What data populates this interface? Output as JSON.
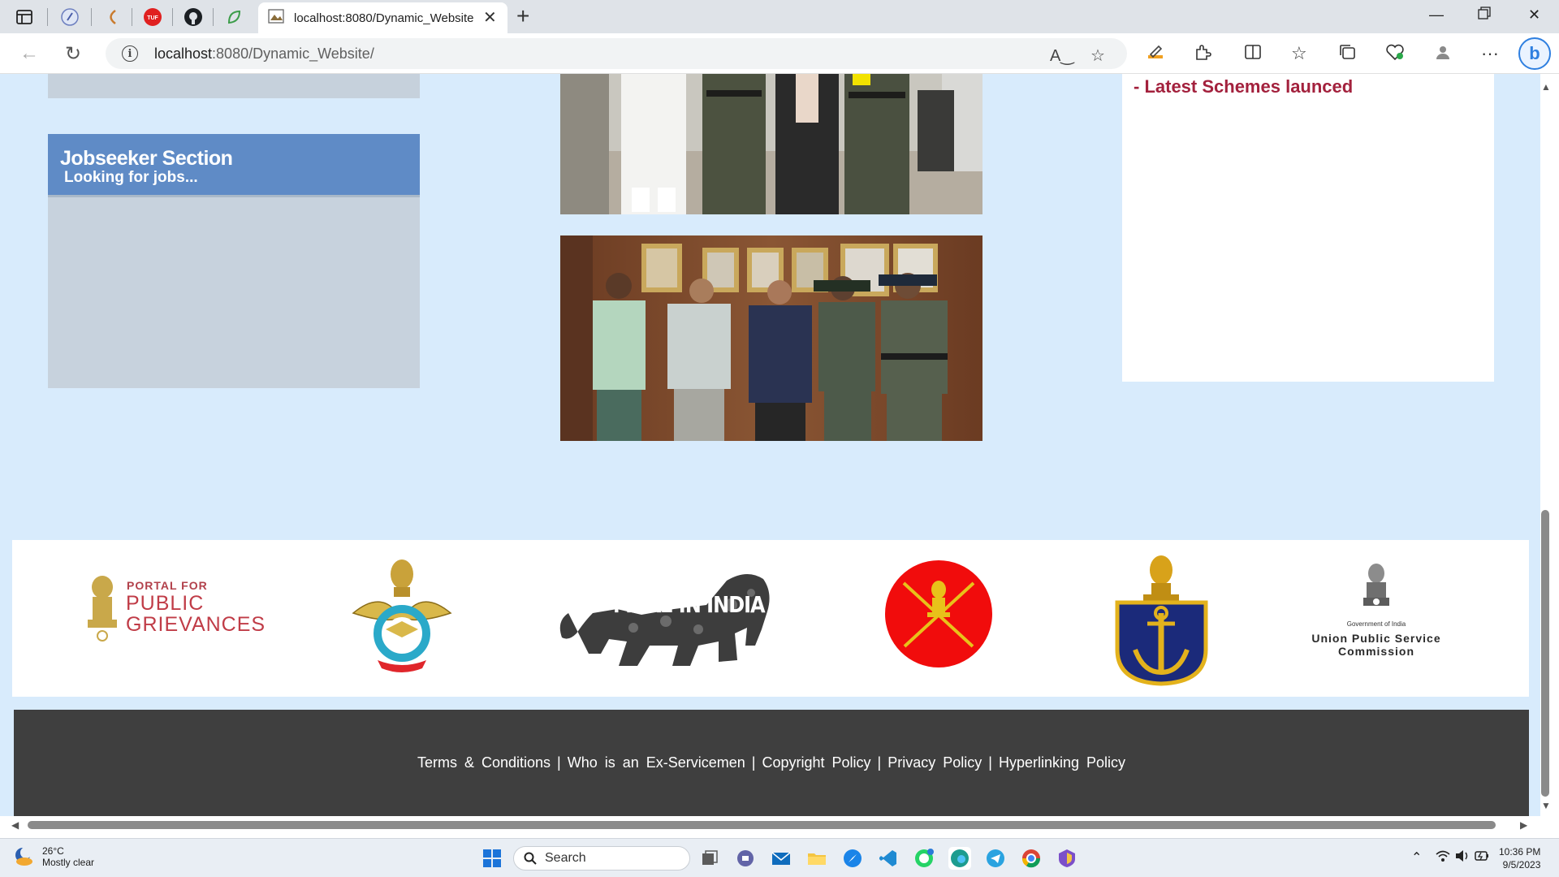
{
  "browser": {
    "active_tab_title": "localhost:8080/Dynamic_Website",
    "url_host": "localhost",
    "url_path": ":8080/Dynamic_Website/",
    "new_tab_symbol": "+"
  },
  "page": {
    "jobseeker": {
      "title": "Jobseeker Section",
      "subtitle": "Looking for jobs..."
    },
    "schemes": {
      "title": "- Latest Schemes launced"
    },
    "logos": [
      {
        "name": "public-grievances",
        "line1": "PORTAL FOR",
        "line2": "PUBLIC",
        "line3": "GRIEVANCES"
      },
      {
        "name": "indian-air-force"
      },
      {
        "name": "make-in-india",
        "label": "MAKE IN INDIA"
      },
      {
        "name": "indian-army"
      },
      {
        "name": "indian-navy"
      },
      {
        "name": "upsc",
        "gov_label": "Government of India",
        "line1": "Union Public Service",
        "line2": "Commission"
      }
    ],
    "footer_links": [
      "Terms & Conditions",
      "Who is an Ex-Servicemen",
      "Copyright Policy",
      "Privacy Policy",
      "Hyperlinking Policy"
    ],
    "footer_separator": "|"
  },
  "taskbar": {
    "weather_temp": "26°C",
    "weather_desc": "Mostly clear",
    "search_label": "Search",
    "time": "10:36 PM",
    "date": "9/5/2023"
  },
  "colors": {
    "page_bg": "#d8ebfc",
    "jobseeker_header": "#5f8bc6",
    "schemes_title": "#a3213d",
    "footer_bg": "#3f3f3f"
  }
}
